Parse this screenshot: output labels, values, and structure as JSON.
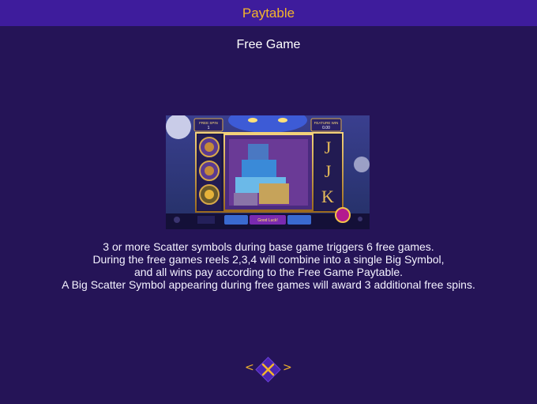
{
  "header": {
    "title": "Paytable"
  },
  "section": {
    "title": "Free Game"
  },
  "preview": {
    "free_spin_label": "FREE SPIN",
    "free_spin_value": "1",
    "feature_label": "FEATURE WIN",
    "feature_value": "0.00",
    "reel_symbols": [
      "J",
      "J",
      "K"
    ],
    "good_luck": "Good Luck!"
  },
  "description": {
    "lines": [
      "3 or more Scatter symbols during base game triggers 6 free games.",
      "During the free games reels 2,3,4 will combine into a single Big Symbol,",
      "and all wins pay according to the Free Game Paytable.",
      "A Big Scatter Symbol appearing during free games will award 3 additional free spins."
    ]
  },
  "nav": {
    "prev_glyph": "<",
    "next_glyph": ">",
    "close_icon": "close-x-icon"
  },
  "colors": {
    "background": "#251457",
    "header": "#3e1c9c",
    "accent_gold": "#f5b52a",
    "text": "#ffffff"
  }
}
